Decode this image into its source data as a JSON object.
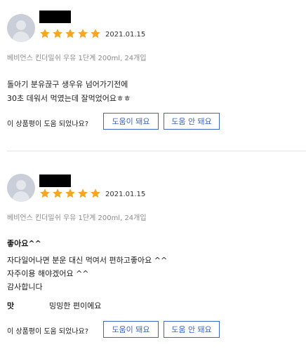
{
  "star_color": "#f5a623",
  "reviews": [
    {
      "rating_stars": 5,
      "date": "2021.01.15",
      "option": "베비언스 킨더밀쉬 우유 1단계 200ml, 24개입",
      "lines": [
        "돌아기 분유끊구 생우유 넘어가기전에",
        "30초 데워서 먹였는데 잘먹었어요ㅎㅎ"
      ],
      "helpful_question": "이 상품평이 도움 되었나요?",
      "helpful_yes": "도움이 돼요",
      "helpful_no": "도움 안 돼요"
    },
    {
      "rating_stars": 5,
      "date": "2021.01.15",
      "option": "베비언스 킨더밀쉬 우유 1단계 200ml, 24개입",
      "headline": "좋아요^^",
      "lines": [
        "자다일어나면 분운 대신 먹여서 편하고좋아요 ^^",
        "자주이용 해야겠어요 ^^",
        "감사합니다"
      ],
      "attribute_label": "맛",
      "attribute_value": "밍밍한 편이에요",
      "helpful_question": "이 상품평이 도움 되었나요?",
      "helpful_yes": "도움이 돼요",
      "helpful_no": "도움 안 돼요"
    }
  ]
}
